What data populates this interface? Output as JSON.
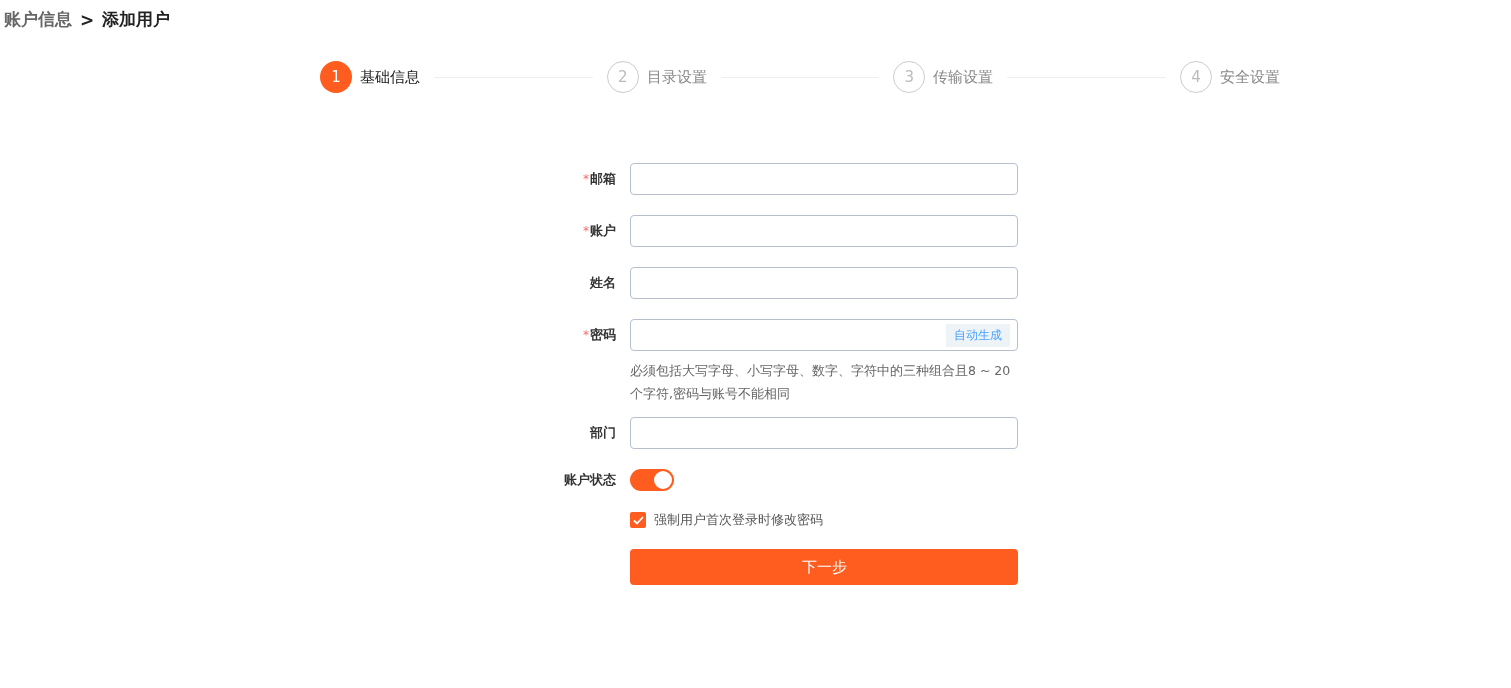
{
  "breadcrumb": [
    {
      "label": "账户信息",
      "current": false
    },
    {
      "label": ">",
      "kind": "separator"
    },
    {
      "label": "添加用户",
      "current": true
    }
  ],
  "steps": [
    {
      "number": "1",
      "label": "基础信息",
      "selected": true
    },
    {
      "number": "2",
      "label": "目录设置",
      "selected": false
    },
    {
      "number": "3",
      "label": "传输设置",
      "selected": false
    },
    {
      "number": "4",
      "label": "安全设置",
      "selected": false
    }
  ],
  "form": {
    "fields": [
      {
        "kind": "input",
        "label": "邮箱",
        "required_mark": "*"
      },
      {
        "kind": "input",
        "label": "账户",
        "required_mark": "*"
      },
      {
        "kind": "input",
        "label": "姓名"
      },
      {
        "kind": "input",
        "label": "密码",
        "required_mark": "*",
        "action": "自动生成",
        "hint": "必须包括大写字母、小写字母、数字、字符中的三种组合且8 ~ 20个字符,密码与账号不能相同"
      },
      {
        "kind": "input",
        "label": "部门"
      },
      {
        "kind": "toggle",
        "label": "账户状态",
        "on": true
      },
      {
        "kind": "checkbox",
        "label": "强制用户首次登录时修改密码",
        "checked": true
      }
    ],
    "submit": "下一步"
  }
}
